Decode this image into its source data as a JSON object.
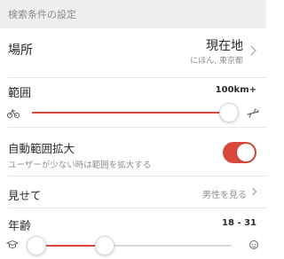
{
  "header": {
    "title": "検索条件の設定"
  },
  "location": {
    "label": "場所",
    "value": "現在地",
    "sub": "にほん, 東京都"
  },
  "range": {
    "label": "範囲",
    "value_text": "100km+",
    "fraction": 1.0,
    "left_icon": "bicycle-icon",
    "right_icon": "airplane-icon"
  },
  "auto_expand": {
    "label": "自動範囲拡大",
    "description": "ユーザーが少ない時は範囲を拡大する",
    "enabled": true
  },
  "show": {
    "label": "見せて",
    "value": "男性を見る"
  },
  "age": {
    "label": "年齢",
    "value_text": "18 - 31",
    "min": 18,
    "max": 31,
    "left_icon": "graduation-cap-icon",
    "right_icon": "elderly-face-icon"
  },
  "colors": {
    "accent": "#d9483b",
    "header_bg": "#efefef",
    "secondary_text": "#8e8e8e"
  }
}
